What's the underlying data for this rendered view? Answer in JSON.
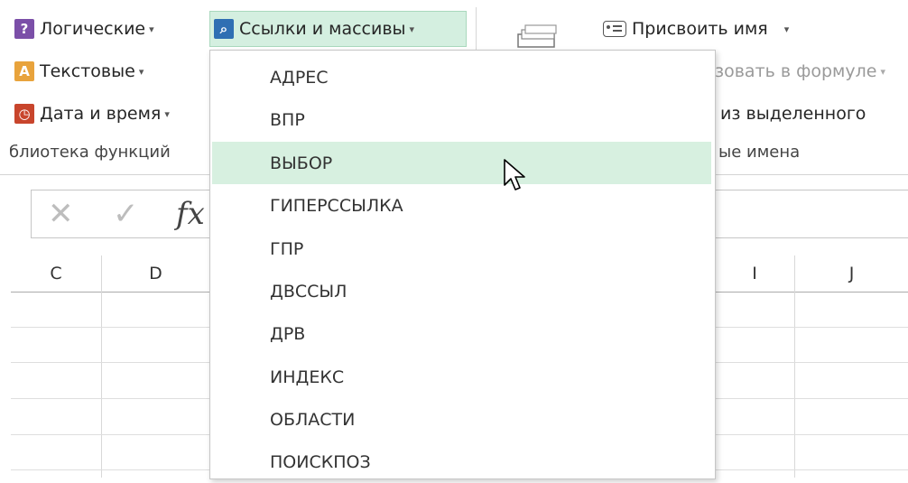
{
  "ribbon": {
    "logical": {
      "label": "Логические",
      "icon": "question-book-icon",
      "color": "#7b4fa8"
    },
    "text": {
      "label": "Текстовые",
      "icon": "text-book-icon",
      "color": "#e8a33c"
    },
    "datetime": {
      "label": "Дата и время",
      "icon": "clock-book-icon",
      "color": "#c8452c"
    },
    "lookup": {
      "label": "Ссылки и массивы",
      "icon": "magnifier-book-icon",
      "color": "#2f6fb3"
    },
    "library_group": "блиотека функций",
    "define_name": {
      "label": "Присвоить имя",
      "icon": "name-tag-icon"
    },
    "use_in_formula": "зовать в формуле",
    "create_from_selection": "из выделенного",
    "names_group": "ые имена"
  },
  "formula_bar": {
    "cancel": "✕",
    "enter": "✓",
    "fx": "fx"
  },
  "columns": [
    "C",
    "D",
    "I",
    "J"
  ],
  "menu": {
    "items": [
      "АДРЕС",
      "ВПР",
      "ВЫБОР",
      "ГИПЕРССЫЛКА",
      "ГПР",
      "ДВССЫЛ",
      "ДРВ",
      "ИНДЕКС",
      "ОБЛАСТИ",
      "ПОИСКПОЗ"
    ],
    "hovered": "ВЫБОР"
  }
}
